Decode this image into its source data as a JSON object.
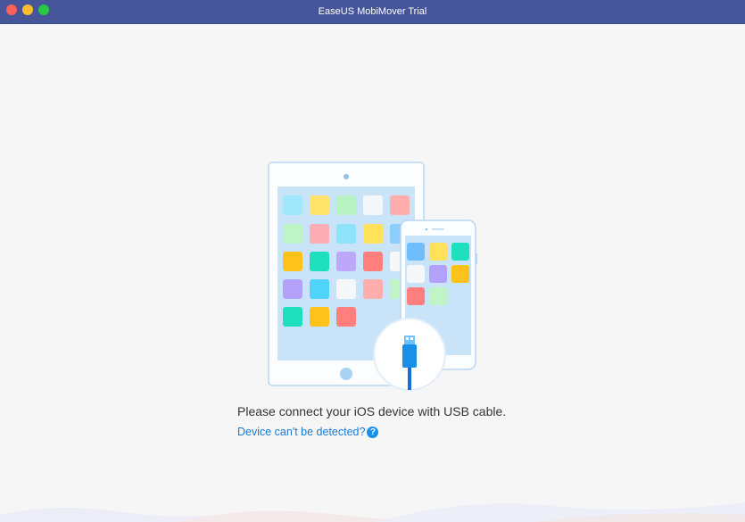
{
  "window": {
    "title": "EaseUS MobiMover Trial"
  },
  "main": {
    "connect_message": "Please connect your iOS device with USB cable.",
    "help_link_label": "Device can't be detected?",
    "help_icon_glyph": "?"
  },
  "icons": {
    "usb": "usb-cable-icon",
    "help": "question-circle-icon"
  },
  "colors": {
    "titlebar": "#46549a",
    "link": "#1a7bd4",
    "accent": "#1a8fe8",
    "background": "#f6f6f6"
  }
}
